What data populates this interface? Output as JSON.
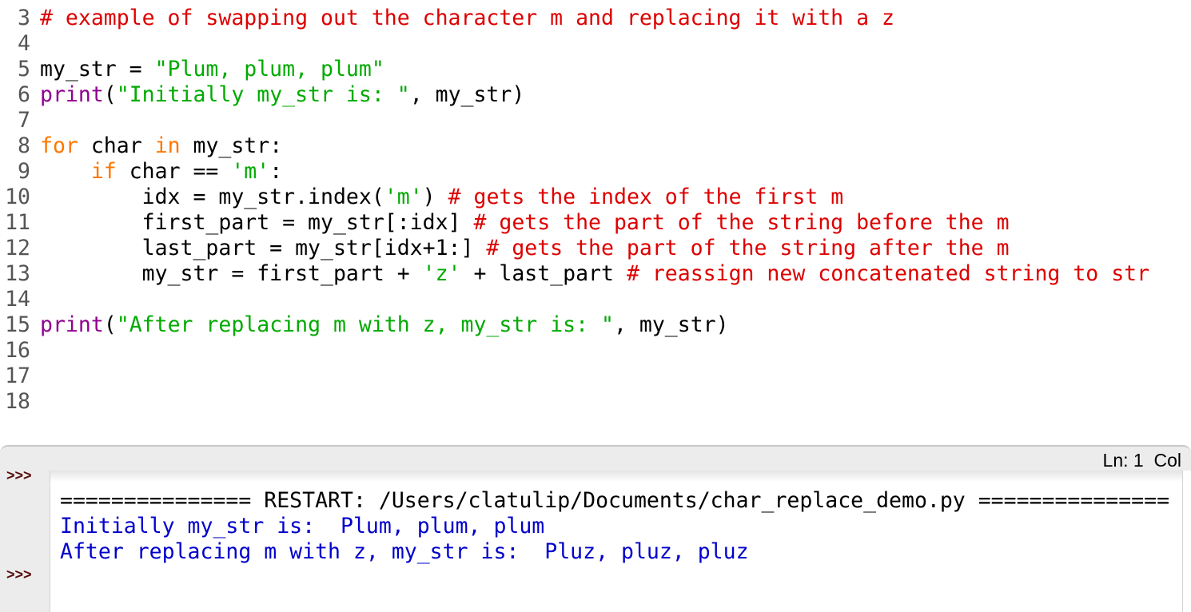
{
  "editor": {
    "lines": [
      {
        "num": "3",
        "segments": [
          {
            "t": "comment",
            "s": "# example of swapping out the character m and replacing it with a z"
          }
        ]
      },
      {
        "num": "4",
        "segments": []
      },
      {
        "num": "5",
        "segments": [
          {
            "t": "plain",
            "s": "my_str = "
          },
          {
            "t": "string",
            "s": "\"Plum, plum, plum\""
          }
        ]
      },
      {
        "num": "6",
        "segments": [
          {
            "t": "builtin",
            "s": "print"
          },
          {
            "t": "plain",
            "s": "("
          },
          {
            "t": "string",
            "s": "\"Initially my_str is: \""
          },
          {
            "t": "plain",
            "s": ", my_str)"
          }
        ]
      },
      {
        "num": "7",
        "segments": []
      },
      {
        "num": "8",
        "segments": [
          {
            "t": "keyword",
            "s": "for"
          },
          {
            "t": "plain",
            "s": " char "
          },
          {
            "t": "keyword",
            "s": "in"
          },
          {
            "t": "plain",
            "s": " my_str:"
          }
        ]
      },
      {
        "num": "9",
        "segments": [
          {
            "t": "plain",
            "s": "    "
          },
          {
            "t": "keyword",
            "s": "if"
          },
          {
            "t": "plain",
            "s": " char == "
          },
          {
            "t": "string",
            "s": "'m'"
          },
          {
            "t": "plain",
            "s": ":"
          }
        ]
      },
      {
        "num": "10",
        "segments": [
          {
            "t": "plain",
            "s": "        idx = my_str.index("
          },
          {
            "t": "string",
            "s": "'m'"
          },
          {
            "t": "plain",
            "s": ") "
          },
          {
            "t": "comment",
            "s": "# gets the index of the first m"
          }
        ]
      },
      {
        "num": "11",
        "segments": [
          {
            "t": "plain",
            "s": "        first_part = my_str[:idx] "
          },
          {
            "t": "comment",
            "s": "# gets the part of the string before the m"
          }
        ]
      },
      {
        "num": "12",
        "segments": [
          {
            "t": "plain",
            "s": "        last_part = my_str[idx+1:] "
          },
          {
            "t": "comment",
            "s": "# gets the part of the string after the m"
          }
        ]
      },
      {
        "num": "13",
        "segments": [
          {
            "t": "plain",
            "s": "        my_str = first_part + "
          },
          {
            "t": "string",
            "s": "'z'"
          },
          {
            "t": "plain",
            "s": " + last_part "
          },
          {
            "t": "comment",
            "s": "# reassign new concatenated string to str"
          }
        ]
      },
      {
        "num": "14",
        "segments": []
      },
      {
        "num": "15",
        "segments": [
          {
            "t": "builtin",
            "s": "print"
          },
          {
            "t": "plain",
            "s": "("
          },
          {
            "t": "string",
            "s": "\"After replacing m with z, my_str is: \""
          },
          {
            "t": "plain",
            "s": ", my_str)"
          }
        ]
      },
      {
        "num": "16",
        "segments": []
      },
      {
        "num": "17",
        "segments": []
      },
      {
        "num": "18",
        "segments": []
      }
    ]
  },
  "statusbar": {
    "position": "Ln: 1  Col"
  },
  "shell": {
    "prompt": ">>>",
    "restart_line": "=============== RESTART: /Users/clatulip/Documents/char_replace_demo.py ===============",
    "output_lines": [
      "Initially my_str is:  Plum, plum, plum",
      "After replacing m with z, my_str is:  Pluz, pluz, pluz"
    ]
  },
  "colors": {
    "comment": "#dd0000",
    "string": "#00aa00",
    "keyword": "#ff7700",
    "builtin": "#900090",
    "shell_output": "#0000cc",
    "prompt": "#5a0f0f"
  }
}
